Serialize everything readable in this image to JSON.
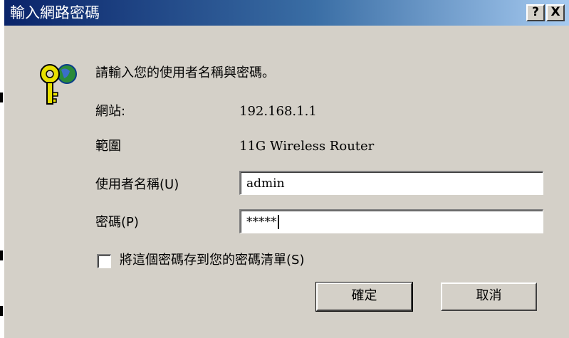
{
  "window": {
    "title": "輸入網路密碼",
    "help_button": "?",
    "close_button": "X"
  },
  "dialog": {
    "prompt": "請輸入您的使用者名稱與密碼。",
    "site_label": "網站:",
    "site_value": "192.168.1.1",
    "realm_label": "範圍",
    "realm_value": "11G Wireless Router",
    "username_label": "使用者名稱(U)",
    "username_value": "admin",
    "password_label": "密碼(P)",
    "password_value": "*****",
    "save_password_label": "將這個密碼存到您的密碼清單(S)",
    "save_password_checked": false,
    "ok_button": "確定",
    "cancel_button": "取消"
  },
  "icons": {
    "dialog_icon": "key-globe-icon"
  },
  "colors": {
    "title_bar_start": "#0a246a",
    "title_bar_end": "#a6caf0",
    "dialog_bg": "#d4d0c8"
  }
}
